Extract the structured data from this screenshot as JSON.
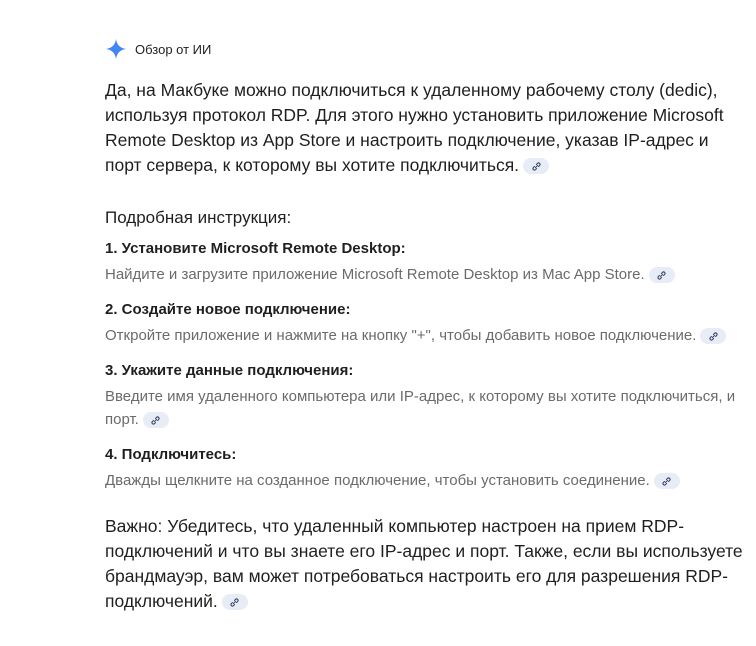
{
  "header": {
    "title": "Обзор от ИИ",
    "icon": "sparkle-icon",
    "accent": "#4285f4"
  },
  "main": {
    "intro": "Да, на Макбуке можно подключиться к удаленному рабочему столу (dedic), используя протокол RDP. Для этого нужно установить приложение Microsoft Remote Desktop из App Store и настроить подключение, указав IP-адрес и порт сервера, к которому вы хотите подключиться.",
    "subhead": "Подробная инструкция:",
    "steps": [
      {
        "title": "1. Установите Microsoft Remote Desktop:",
        "desc": "Найдите и загрузите приложение Microsoft Remote Desktop из Mac App Store."
      },
      {
        "title": "2. Создайте новое подключение:",
        "desc": "Откройте приложение и нажмите на кнопку \"+\", чтобы добавить новое подключение."
      },
      {
        "title": "3. Укажите данные подключения:",
        "desc": "Введите имя удаленного компьютера или IP-адрес, к которому вы хотите подключиться, и порт."
      },
      {
        "title": "4. Подключитесь:",
        "desc": "Дважды щелкните на созданное подключение, чтобы установить соединение."
      }
    ],
    "important": "Важно: Убедитесь, что удаленный компьютер настроен на прием RDP-подключений и что вы знаете его IP-адрес и порт. Также, если вы используете брандмауэр, вам может потребоваться настроить его для разрешения RDP-подключений."
  }
}
